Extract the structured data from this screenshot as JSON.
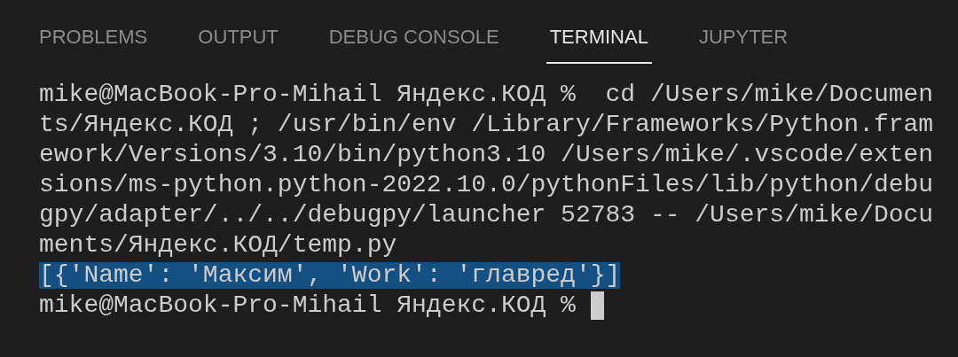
{
  "tabs": [
    {
      "label": "PROBLEMS",
      "selected": false
    },
    {
      "label": "OUTPUT",
      "selected": false
    },
    {
      "label": "DEBUG CONSOLE",
      "selected": false
    },
    {
      "label": "TERMINAL",
      "selected": true
    },
    {
      "label": "JUPYTER",
      "selected": false
    }
  ],
  "terminal": {
    "lines": [
      {
        "text": "mike@MacBook-Pro-Mihail Яндекс.КОД %  cd /Users/mike/Documen",
        "highlighted": false
      },
      {
        "text": "ts/Яндекс.КОД ; /usr/bin/env /Library/Frameworks/Python.fram",
        "highlighted": false
      },
      {
        "text": "ework/Versions/3.10/bin/python3.10 /Users/mike/.vscode/exten",
        "highlighted": false
      },
      {
        "text": "sions/ms-python.python-2022.10.0/pythonFiles/lib/python/debu",
        "highlighted": false
      },
      {
        "text": "gpy/adapter/../../debugpy/launcher 52783 -- /Users/mike/Docu",
        "highlighted": false
      },
      {
        "text": "ments/Яндекс.КОД/temp.py",
        "highlighted": false
      },
      {
        "text": "[{'Name': 'Максим', 'Work': 'главред'}]",
        "highlighted": true
      },
      {
        "text": "mike@MacBook-Pro-Mihail Яндекс.КОД % ",
        "highlighted": false,
        "cursor": true
      }
    ]
  }
}
